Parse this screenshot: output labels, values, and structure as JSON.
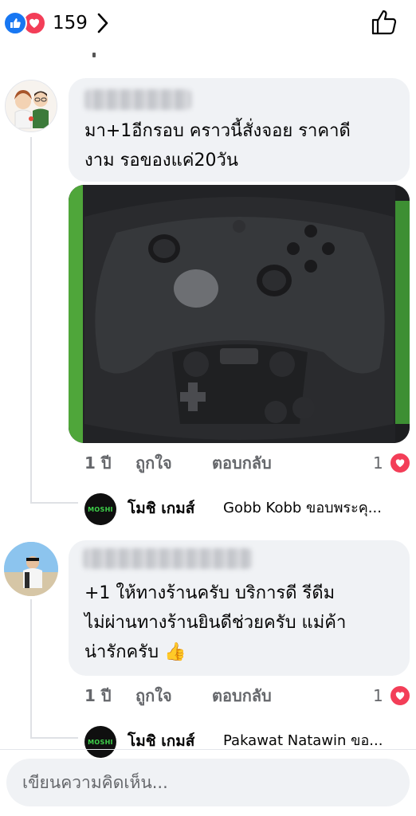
{
  "header": {
    "reaction_count": "159",
    "reaction_types": [
      "like-icon",
      "love-icon"
    ],
    "colors": {
      "like": "#1877f2",
      "love": "#f33e58"
    }
  },
  "comments": [
    {
      "text": "มา+1อีกรอบ คราวนี้สั่งจอย ราคาดี\nงาม รอของแค่20วัน",
      "time": "1 ปี",
      "like_label": "ถูกใจ",
      "reply_label": "ตอบกลับ",
      "reaction_count": "1",
      "reply_preview": {
        "avatar_text": "MOSHI",
        "name": "โมชิ เกมส์",
        "text": "Gobb Kobb ขอบพระคุ..."
      }
    },
    {
      "text": "+1 ให้ทางร้านครับ บริการดี รีดีม\nไม่ผ่านทางร้านยินดีช่วยครับ แม่ค้า\nน่ารักครับ 👍",
      "time": "1 ปี",
      "like_label": "ถูกใจ",
      "reply_label": "ตอบกลับ",
      "reaction_count": "1",
      "reply_preview": {
        "avatar_text": "MOSHI",
        "name": "โมชิ เกมส์",
        "text": "Pakawat Natawin ขอ..."
      }
    }
  ],
  "composer": {
    "placeholder": "เขียนความคิดเห็น..."
  }
}
